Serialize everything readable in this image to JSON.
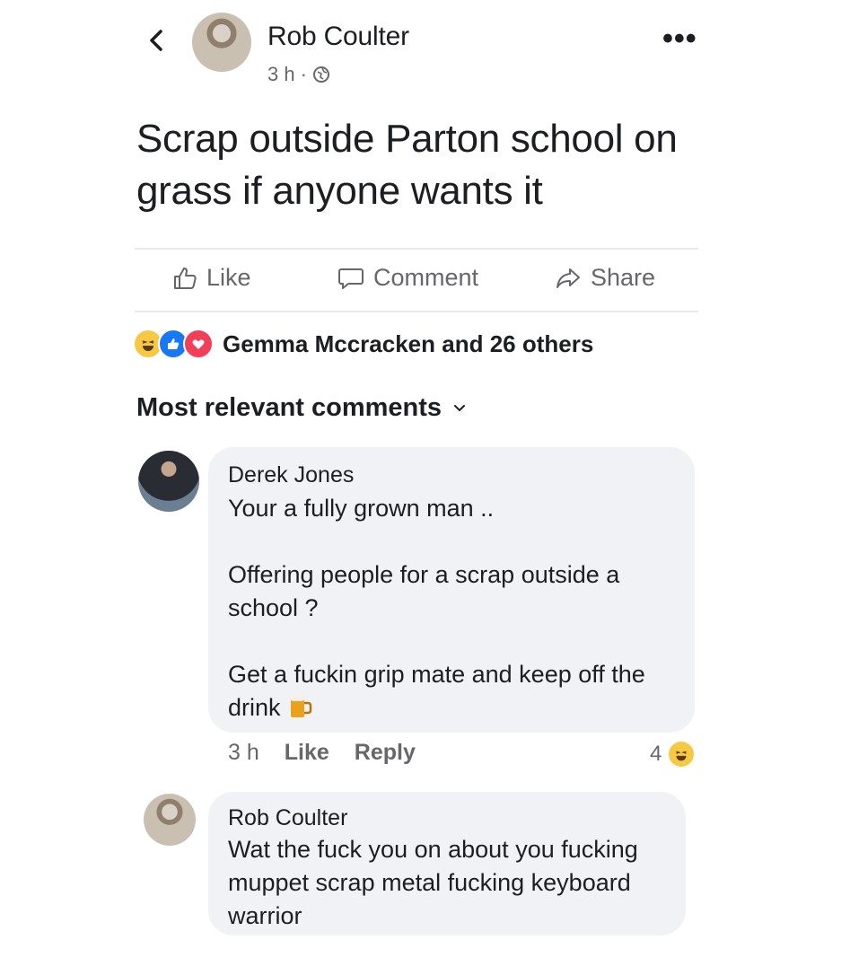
{
  "post": {
    "author": "Rob Coulter",
    "time": "3 h",
    "separator": "·",
    "more_label": "•••",
    "text": "Scrap outside Parton school on grass if anyone wants it"
  },
  "actions": {
    "like": "Like",
    "comment": "Comment",
    "share": "Share"
  },
  "reactions": {
    "summary": "Gemma Mccracken and 26 others"
  },
  "comments_filter": {
    "label": "Most relevant comments"
  },
  "comments": [
    {
      "author": "Derek Jones",
      "text": "Your a fully grown man ..\n\nOffering people for a scrap outside a school ?\n\nGet a fuckin grip mate and keep off the drink",
      "time": "3 h",
      "like": "Like",
      "reply": "Reply",
      "reaction_count": "4"
    },
    {
      "author": "Rob Coulter",
      "text": "Wat the fuck you on about you fucking muppet scrap metal fucking keyboard warrior"
    }
  ],
  "colors": {
    "text": "#1c1e21",
    "secondary": "#65676b",
    "bubble": "#f0f2f5",
    "like_blue": "#1877f2",
    "love_red": "#f33e58",
    "haha_yellow": "#f7c843"
  }
}
